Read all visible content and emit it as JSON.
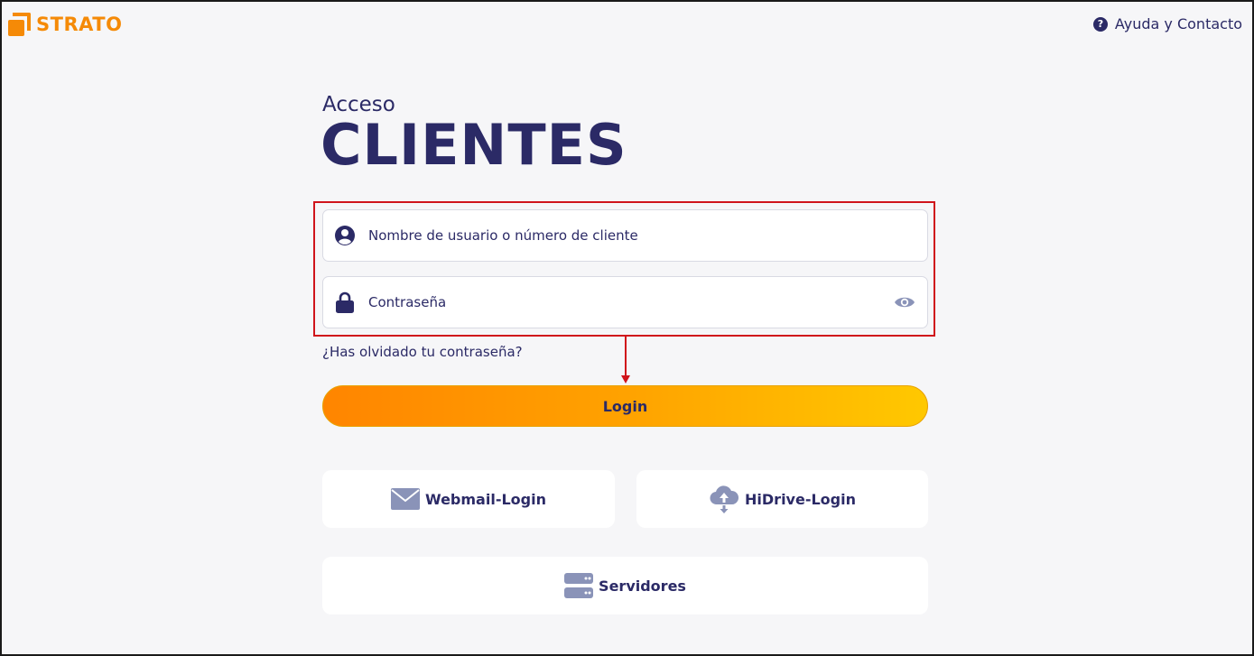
{
  "brand": {
    "name": "STRATO",
    "color": "#f58a07"
  },
  "header": {
    "help_label": "Ayuda y Contacto",
    "help_icon": "question-circle-icon"
  },
  "title": {
    "small": "Acceso",
    "big": "CLIENTES"
  },
  "form": {
    "username_placeholder": "Nombre de usuario o número de cliente",
    "username_value": "",
    "password_placeholder": "Contraseña",
    "password_value": "",
    "forgot_label": "¿Has olvidado tu contraseña?",
    "login_label": "Login"
  },
  "cards": {
    "webmail_label": "Webmail-Login",
    "hidrive_label": "HiDrive-Login",
    "servers_label": "Servidores"
  },
  "colors": {
    "primary_text": "#2b2a66",
    "accent_orange": "#ff8500",
    "accent_yellow": "#ffc800",
    "annotation_red": "#d0141b",
    "icon_grey": "#8a93b8"
  }
}
